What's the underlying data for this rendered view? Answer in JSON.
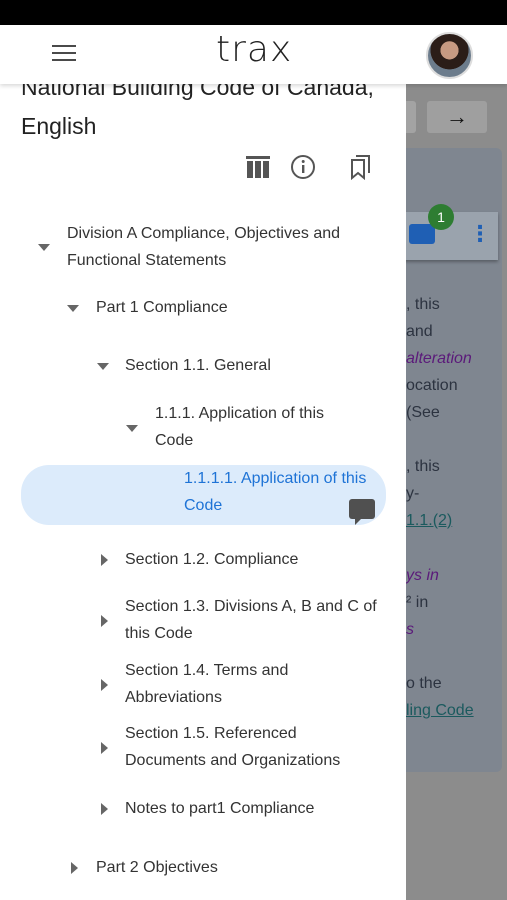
{
  "app": {
    "logo": "trax",
    "menu_icon": "hamburger-icon",
    "avatar_icon": "user-avatar"
  },
  "document": {
    "title": "National Building Code of Canada, English"
  },
  "toolbar": {
    "icons": [
      "library-icon",
      "info-icon",
      "bookmark-icon"
    ]
  },
  "tree": [
    {
      "label": "Division A Compliance, Objectives and Functional Statements",
      "state": "expanded"
    },
    {
      "label": "Part 1 Compliance",
      "state": "expanded"
    },
    {
      "label": "Section 1.1. General",
      "state": "expanded"
    },
    {
      "label": "1.1.1. Application of this Code",
      "state": "expanded"
    },
    {
      "label": "1.1.1.1. Application of this Code",
      "state": "selected"
    },
    {
      "label": "Section 1.2. Compliance",
      "state": "collapsed"
    },
    {
      "label": "Section 1.3. Divisions A, B and C of this Code",
      "state": "collapsed"
    },
    {
      "label": "Section 1.4. Terms and Abbreviations",
      "state": "collapsed"
    },
    {
      "label": "Section 1.5. Referenced Documents and Organizations",
      "state": "collapsed"
    },
    {
      "label": "Notes to part1 Compliance",
      "state": "collapsed"
    },
    {
      "label": "Part 2 Objectives",
      "state": "collapsed"
    }
  ],
  "background": {
    "badge_count": "1",
    "next_arrow": "→",
    "kebab": "⋮",
    "fragments": [
      ", this",
      "and",
      "alteration",
      "ocation",
      "(See",
      ", this",
      "y-",
      "1.1.(2)",
      "ys in",
      "² in",
      "s",
      "o the",
      "ling Code"
    ]
  },
  "colors": {
    "accent": "#1e73d6",
    "selected_bg": "#dcebfb",
    "badge": "#2e7d32"
  }
}
